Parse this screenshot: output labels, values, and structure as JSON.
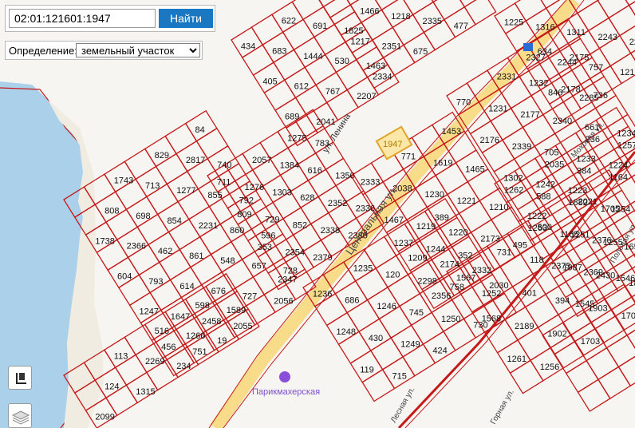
{
  "search": {
    "value": "02:01:121601:1947",
    "button": "Найти"
  },
  "definition": {
    "label": "Определение:",
    "selected": "земельный участок"
  },
  "map": {
    "highlighted_plot": "1947",
    "streets": [
      "ул. Ленина",
      "Центральная ул.",
      "Моховая ул.",
      "Полевая ул.",
      "Лесная ул.",
      "Горная ул."
    ],
    "poi": "Парикмахерская",
    "plot_labels": [
      "1743",
      "829",
      "84",
      "808",
      "713",
      "2817",
      "1738",
      "698",
      "1277",
      "740",
      "2366",
      "854",
      "855",
      "604",
      "462",
      "2231",
      "792",
      "793",
      "861",
      "860",
      "1247",
      "614",
      "548",
      "596",
      "1647",
      "676",
      "657",
      "456",
      "2458",
      "727",
      "728",
      "751",
      "2055",
      "2056",
      "711",
      "2057",
      "1275",
      "1276",
      "1384",
      "783",
      "809",
      "1303",
      "616",
      "729",
      "628",
      "1350",
      "353",
      "852",
      "2352",
      "2354",
      "2338",
      "2336",
      "2347",
      "2379",
      "2380",
      "434",
      "622",
      "683",
      "691",
      "405",
      "1444",
      "1825",
      "612",
      "530",
      "689",
      "767",
      "1463",
      "2041",
      "2207",
      "1466",
      "1217",
      "1218",
      "2351",
      "2335",
      "2334",
      "675",
      "477",
      "2333",
      "771",
      "1453",
      "2038",
      "1619",
      "1467",
      "1230",
      "1465",
      "1219",
      "1221",
      "1209",
      "1220",
      "1210",
      "2174",
      "2173",
      "2356",
      "2332",
      "495",
      "770",
      "2331",
      "634",
      "1231",
      "1232",
      "2175",
      "2176",
      "2177",
      "2178",
      "2339",
      "2340",
      "736",
      "1302",
      "705",
      "661",
      "1242",
      "1233",
      "1234",
      "1222",
      "1223",
      "1224",
      "1225",
      "1316",
      "2327",
      "1311",
      "2244",
      "2243",
      "846",
      "757",
      "2284",
      "2285",
      "121",
      "1236",
      "1235",
      "1237",
      "389",
      "686",
      "120",
      "1244",
      "1248",
      "1246",
      "2298",
      "352",
      "430",
      "745",
      "758",
      "119",
      "1249",
      "1250",
      "1252",
      "715",
      "424",
      "730",
      "1567",
      "731",
      "500",
      "2021",
      "2030",
      "118",
      "1251",
      "1254",
      "1568",
      "401",
      "1987",
      "1255",
      "2189",
      "394",
      "2430",
      "1261",
      "1902",
      "1903",
      "1883",
      "1256",
      "1703",
      "1706",
      "1262",
      "2035",
      "236",
      "588",
      "384",
      "1257",
      "1263",
      "1882",
      "1164",
      "1165",
      "1705",
      "2375",
      "2376",
      "2369",
      "1656",
      "1545",
      "1546",
      "113",
      "516",
      "598",
      "124",
      "2269",
      "1266",
      "1589",
      "2099",
      "1315",
      "234",
      "19"
    ]
  }
}
